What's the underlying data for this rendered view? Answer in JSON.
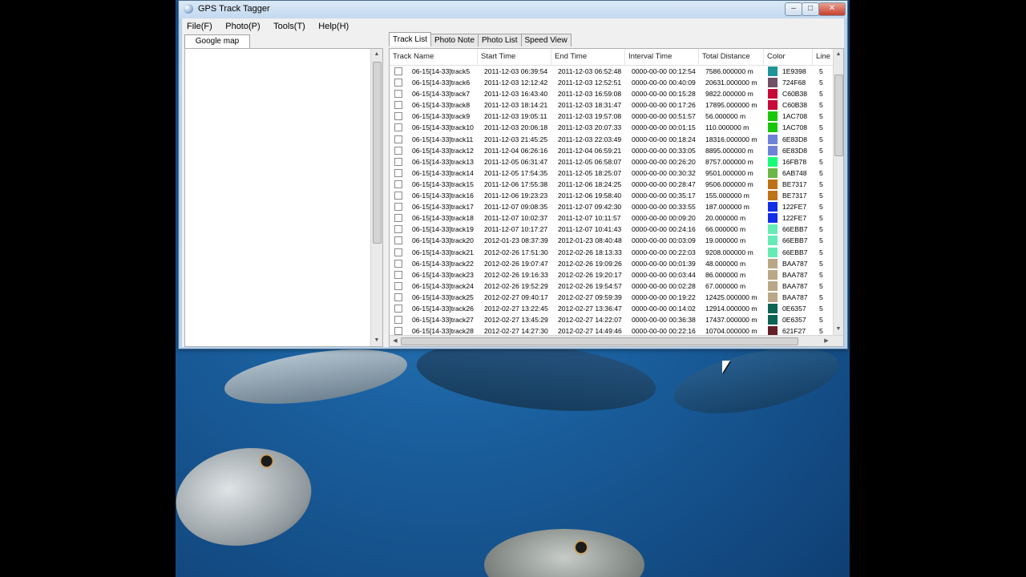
{
  "window": {
    "title": "GPS Track Tagger"
  },
  "menu": [
    "File(F)",
    "Photo(P)",
    "Tools(T)",
    "Help(H)"
  ],
  "left_panel": {
    "tab": "Google map"
  },
  "tabs": [
    {
      "label": "Track List",
      "active": true
    },
    {
      "label": "Photo Note",
      "active": false
    },
    {
      "label": "Photo List",
      "active": false
    },
    {
      "label": "Speed View",
      "active": false
    }
  ],
  "columns": [
    "Track Name",
    "Start Time",
    "End Time",
    "Interval Time",
    "Total Distance",
    "Color",
    "Line"
  ],
  "rows": [
    {
      "name": "06-15[14-33]track5",
      "start": "2011-12-03 06:39:54",
      "end": "2011-12-03 06:52:48",
      "interval": "0000-00-00 00:12:54",
      "distance": "7586.000000 m",
      "color": "1E9398",
      "color_hex": "#1E9398",
      "line": "5"
    },
    {
      "name": "06-15[14-33]track6",
      "start": "2011-12-03 12:12:42",
      "end": "2011-12-03 12:52:51",
      "interval": "0000-00-00 00:40:09",
      "distance": "20631.000000 m",
      "color": "724F68",
      "color_hex": "#724F68",
      "line": "5"
    },
    {
      "name": "06-15[14-33]track7",
      "start": "2011-12-03 16:43:40",
      "end": "2011-12-03 16:59:08",
      "interval": "0000-00-00 00:15:28",
      "distance": "9822.000000 m",
      "color": "C60B38",
      "color_hex": "#C60B38",
      "line": "5"
    },
    {
      "name": "06-15[14-33]track8",
      "start": "2011-12-03 18:14:21",
      "end": "2011-12-03 18:31:47",
      "interval": "0000-00-00 00:17:26",
      "distance": "17895.000000 m",
      "color": "C60B38",
      "color_hex": "#C60B38",
      "line": "5"
    },
    {
      "name": "06-15[14-33]track9",
      "start": "2011-12-03 19:05:11",
      "end": "2011-12-03 19:57:08",
      "interval": "0000-00-00 00:51:57",
      "distance": "56.000000 m",
      "color": "1AC708",
      "color_hex": "#1AC708",
      "line": "5"
    },
    {
      "name": "06-15[14-33]track10",
      "start": "2011-12-03 20:06:18",
      "end": "2011-12-03 20:07:33",
      "interval": "0000-00-00 00:01:15",
      "distance": "110.000000 m",
      "color": "1AC708",
      "color_hex": "#1AC708",
      "line": "5"
    },
    {
      "name": "06-15[14-33]track11",
      "start": "2011-12-03 21:45:25",
      "end": "2011-12-03 22:03:49",
      "interval": "0000-00-00 00:18:24",
      "distance": "18316.000000 m",
      "color": "6E83D8",
      "color_hex": "#6E83D8",
      "line": "5"
    },
    {
      "name": "06-15[14-33]track12",
      "start": "2011-12-04 06:26:16",
      "end": "2011-12-04 06:59:21",
      "interval": "0000-00-00 00:33:05",
      "distance": "8895.000000 m",
      "color": "6E83D8",
      "color_hex": "#6E83D8",
      "line": "5"
    },
    {
      "name": "06-15[14-33]track13",
      "start": "2011-12-05 06:31:47",
      "end": "2011-12-05 06:58:07",
      "interval": "0000-00-00 00:26:20",
      "distance": "8757.000000 m",
      "color": "16FB78",
      "color_hex": "#16FB78",
      "line": "5"
    },
    {
      "name": "06-15[14-33]track14",
      "start": "2011-12-05 17:54:35",
      "end": "2011-12-05 18:25:07",
      "interval": "0000-00-00 00:30:32",
      "distance": "9501.000000 m",
      "color": "6AB748",
      "color_hex": "#6AB748",
      "line": "5"
    },
    {
      "name": "06-15[14-33]track15",
      "start": "2011-12-06 17:55:38",
      "end": "2011-12-06 18:24:25",
      "interval": "0000-00-00 00:28:47",
      "distance": "9506.000000 m",
      "color": "BE7317",
      "color_hex": "#BE7317",
      "line": "5"
    },
    {
      "name": "06-15[14-33]track16",
      "start": "2011-12-06 19:23:23",
      "end": "2011-12-06 19:58:40",
      "interval": "0000-00-00 00:35:17",
      "distance": "155.000000 m",
      "color": "BE7317",
      "color_hex": "#BE7317",
      "line": "5"
    },
    {
      "name": "06-15[14-33]track17",
      "start": "2011-12-07 09:08:35",
      "end": "2011-12-07 09:42:30",
      "interval": "0000-00-00 00:33:55",
      "distance": "187.000000 m",
      "color": "122FE7",
      "color_hex": "#122FE7",
      "line": "5"
    },
    {
      "name": "06-15[14-33]track18",
      "start": "2011-12-07 10:02:37",
      "end": "2011-12-07 10:11:57",
      "interval": "0000-00-00 00:09:20",
      "distance": "20.000000 m",
      "color": "122FE7",
      "color_hex": "#122FE7",
      "line": "5"
    },
    {
      "name": "06-15[14-33]track19",
      "start": "2011-12-07 10:17:27",
      "end": "2011-12-07 10:41:43",
      "interval": "0000-00-00 00:24:16",
      "distance": "66.000000 m",
      "color": "66EBB7",
      "color_hex": "#66EBB7",
      "line": "5"
    },
    {
      "name": "06-15[14-33]track20",
      "start": "2012-01-23 08:37:39",
      "end": "2012-01-23 08:40:48",
      "interval": "0000-00-00 00:03:09",
      "distance": "19.000000 m",
      "color": "66EBB7",
      "color_hex": "#66EBB7",
      "line": "5"
    },
    {
      "name": "06-15[14-33]track21",
      "start": "2012-02-26 17:51:30",
      "end": "2012-02-26 18:13:33",
      "interval": "0000-00-00 00:22:03",
      "distance": "9208.000000 m",
      "color": "66EBB7",
      "color_hex": "#66EBB7",
      "line": "5"
    },
    {
      "name": "06-15[14-33]track22",
      "start": "2012-02-26 19:07:47",
      "end": "2012-02-26 19:09:26",
      "interval": "0000-00-00 00:01:39",
      "distance": "48.000000 m",
      "color": "BAA787",
      "color_hex": "#BAA787",
      "line": "5"
    },
    {
      "name": "06-15[14-33]track23",
      "start": "2012-02-26 19:16:33",
      "end": "2012-02-26 19:20:17",
      "interval": "0000-00-00 00:03:44",
      "distance": "86.000000 m",
      "color": "BAA787",
      "color_hex": "#BAA787",
      "line": "5"
    },
    {
      "name": "06-15[14-33]track24",
      "start": "2012-02-26 19:52:29",
      "end": "2012-02-26 19:54:57",
      "interval": "0000-00-00 00:02:28",
      "distance": "67.000000 m",
      "color": "BAA787",
      "color_hex": "#BAA787",
      "line": "5"
    },
    {
      "name": "06-15[14-33]track25",
      "start": "2012-02-27 09:40:17",
      "end": "2012-02-27 09:59:39",
      "interval": "0000-00-00 00:19:22",
      "distance": "12425.000000 m",
      "color": "BAA787",
      "color_hex": "#BAA787",
      "line": "5"
    },
    {
      "name": "06-15[14-33]track26",
      "start": "2012-02-27 13:22:45",
      "end": "2012-02-27 13:36:47",
      "interval": "0000-00-00 00:14:02",
      "distance": "12914.000000 m",
      "color": "0E6357",
      "color_hex": "#0E6357",
      "line": "5"
    },
    {
      "name": "06-15[14-33]track27",
      "start": "2012-02-27 13:45:29",
      "end": "2012-02-27 14:22:07",
      "interval": "0000-00-00 00:36:38",
      "distance": "17437.000000 m",
      "color": "0E6357",
      "color_hex": "#0E6357",
      "line": "5"
    },
    {
      "name": "06-15[14-33]track28",
      "start": "2012-02-27 14:27:30",
      "end": "2012-02-27 14:49:46",
      "interval": "0000-00-00 00:22:16",
      "distance": "10704.000000 m",
      "color": "621F27",
      "color_hex": "#621F27",
      "line": "5"
    }
  ]
}
